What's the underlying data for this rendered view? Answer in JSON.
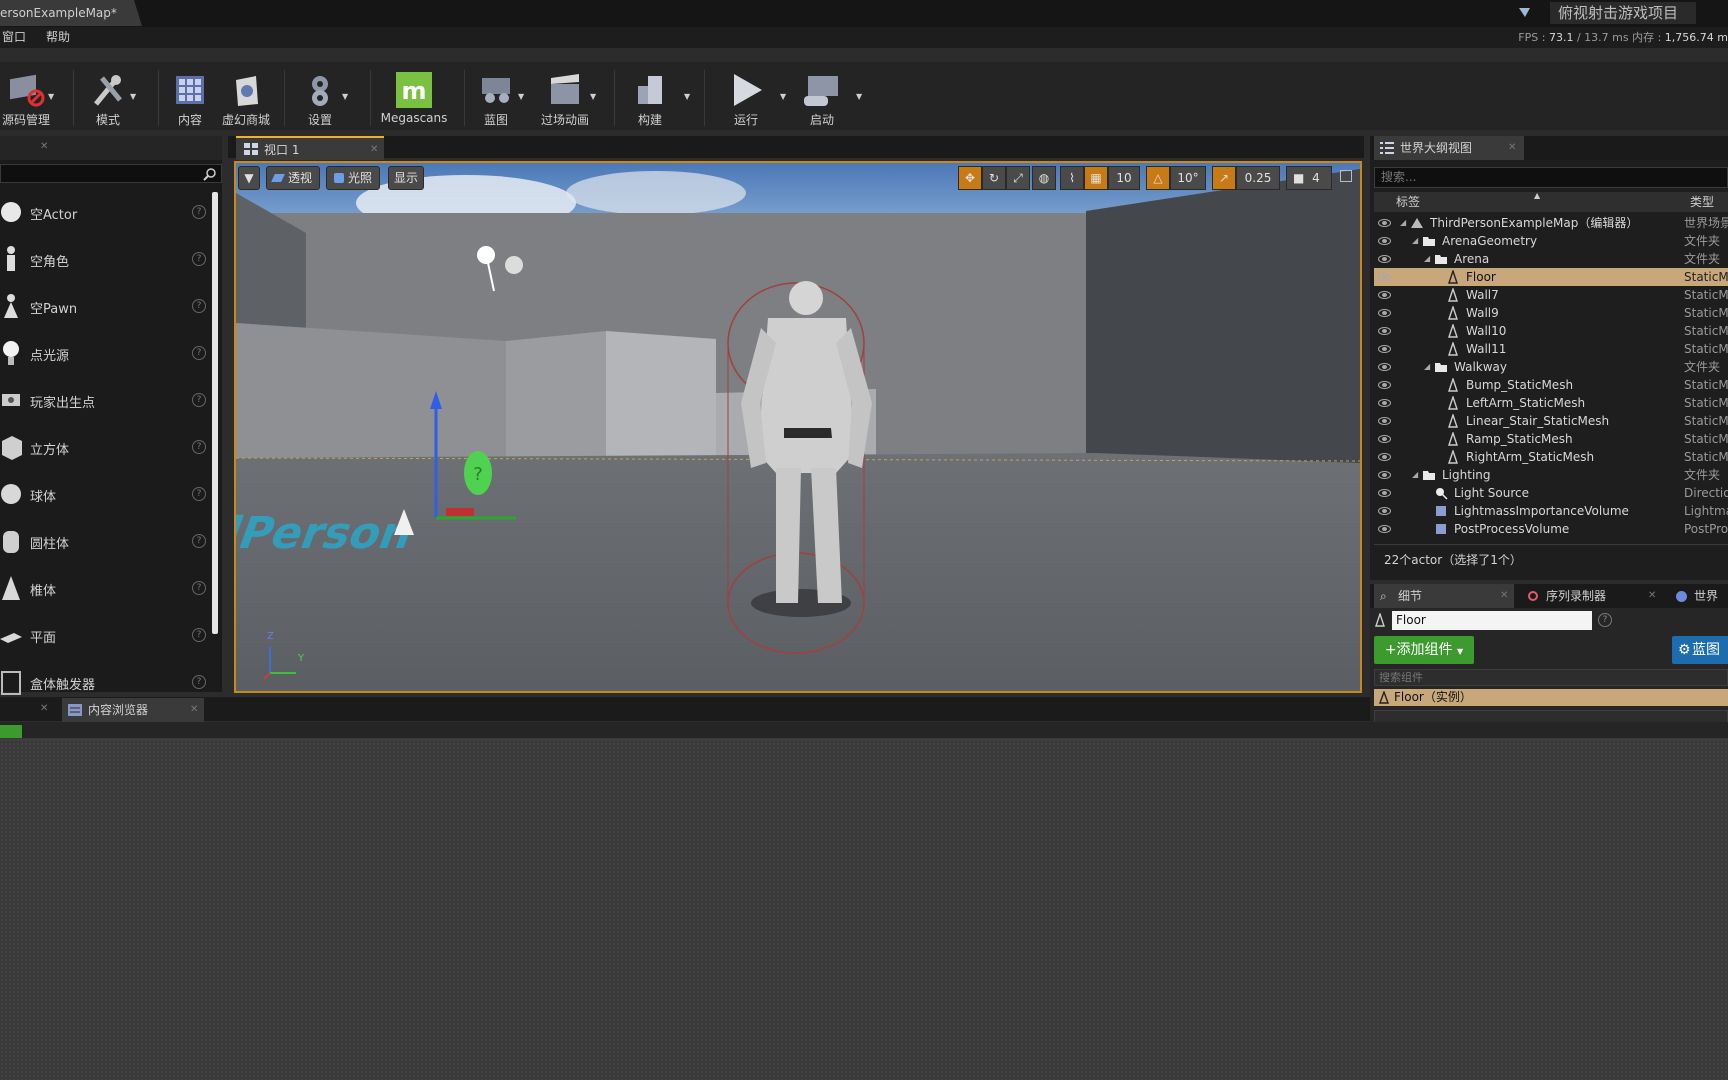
{
  "titlebar": {
    "doc_tab": "ersonExampleMap*",
    "project": "俯视射击游戏项目"
  },
  "menu": {
    "items": [
      "窗口",
      "帮助"
    ]
  },
  "stats": {
    "fps_label": "FPS :",
    "fps": "73.1",
    "ms": "/ 13.7 ms",
    "mem_label": "内存 :",
    "mem": "1,756.74 m"
  },
  "toolbar": {
    "items": [
      {
        "label": "源码管理",
        "icon": "source-control-icon"
      },
      {
        "label": "模式",
        "icon": "modes-icon"
      },
      {
        "label": "内容",
        "icon": "content-icon"
      },
      {
        "label": "虚幻商城",
        "icon": "marketplace-icon"
      },
      {
        "label": "设置",
        "icon": "settings-icon"
      },
      {
        "label": "Megascans",
        "icon": "megascans-icon"
      },
      {
        "label": "蓝图",
        "icon": "blueprint-icon"
      },
      {
        "label": "过场动画",
        "icon": "cinematics-icon"
      },
      {
        "label": "构建",
        "icon": "build-icon"
      },
      {
        "label": "运行",
        "icon": "play-icon"
      },
      {
        "label": "启动",
        "icon": "launch-icon"
      }
    ]
  },
  "place_panel": {
    "items": [
      "空Actor",
      "空角色",
      "空Pawn",
      "点光源",
      "玩家出生点",
      "立方体",
      "球体",
      "圆柱体",
      "椎体",
      "平面",
      "盒体触发器"
    ],
    "help": "?"
  },
  "viewport": {
    "tab": "视口 1",
    "buttons": {
      "perspective": "透视",
      "lit": "光照",
      "show": "显示"
    },
    "grid_snap": "10",
    "rot_snap": "10°",
    "scale_snap": "0.25",
    "cam_speed": "4",
    "axis": {
      "z": "Z",
      "y": "Y"
    }
  },
  "outliner": {
    "tab": "世界大纲视图",
    "search_placeholder": "搜索...",
    "col_label": "标签",
    "col_type": "类型",
    "rows": [
      {
        "name": "ThirdPersonExampleMap（编辑器）",
        "type": "世界场景",
        "depth": 0,
        "icon": "world-icon"
      },
      {
        "name": "ArenaGeometry",
        "type": "文件夹",
        "depth": 1,
        "icon": "folder-icon"
      },
      {
        "name": "Arena",
        "type": "文件夹",
        "depth": 2,
        "icon": "folder-icon"
      },
      {
        "name": "Floor",
        "type": "StaticMe",
        "depth": 3,
        "icon": "mesh-icon",
        "selected": true
      },
      {
        "name": "Wall7",
        "type": "StaticMe",
        "depth": 3,
        "icon": "mesh-icon"
      },
      {
        "name": "Wall9",
        "type": "StaticMe",
        "depth": 3,
        "icon": "mesh-icon"
      },
      {
        "name": "Wall10",
        "type": "StaticMe",
        "depth": 3,
        "icon": "mesh-icon"
      },
      {
        "name": "Wall11",
        "type": "StaticMe",
        "depth": 3,
        "icon": "mesh-icon"
      },
      {
        "name": "Walkway",
        "type": "文件夹",
        "depth": 2,
        "icon": "folder-icon"
      },
      {
        "name": "Bump_StaticMesh",
        "type": "StaticMe",
        "depth": 3,
        "icon": "mesh-icon"
      },
      {
        "name": "LeftArm_StaticMesh",
        "type": "StaticMe",
        "depth": 3,
        "icon": "mesh-icon"
      },
      {
        "name": "Linear_Stair_StaticMesh",
        "type": "StaticMe",
        "depth": 3,
        "icon": "mesh-icon"
      },
      {
        "name": "Ramp_StaticMesh",
        "type": "StaticMe",
        "depth": 3,
        "icon": "mesh-icon"
      },
      {
        "name": "RightArm_StaticMesh",
        "type": "StaticMe",
        "depth": 3,
        "icon": "mesh-icon"
      },
      {
        "name": "Lighting",
        "type": "文件夹",
        "depth": 1,
        "icon": "folder-icon"
      },
      {
        "name": "Light Source",
        "type": "Direction",
        "depth": 2,
        "icon": "light-icon"
      },
      {
        "name": "LightmassImportanceVolume",
        "type": "Lightma",
        "depth": 2,
        "icon": "volume-icon"
      },
      {
        "name": "PostProcessVolume",
        "type": "PostPro",
        "depth": 2,
        "icon": "volume-icon"
      }
    ],
    "count": "22个actor（选择了1个）"
  },
  "details": {
    "tabs": [
      "细节",
      "序列录制器",
      "世界场"
    ],
    "name_value": "Floor",
    "add_component": "+添加组件",
    "blueprint": "蓝图",
    "comp_search_placeholder": "搜索组件",
    "instance_row": "Floor（实例）"
  },
  "bottom": {
    "content_browser_tab": "内容浏览器"
  }
}
